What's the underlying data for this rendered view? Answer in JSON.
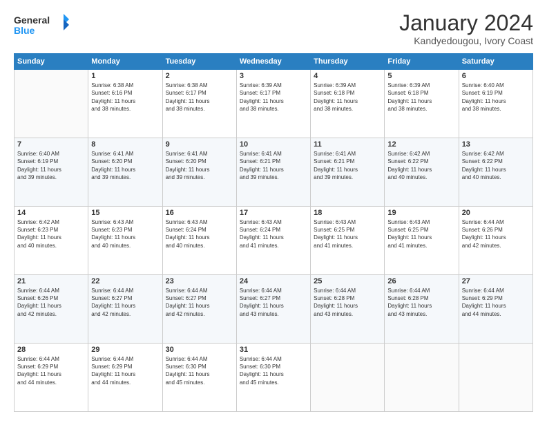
{
  "logo": {
    "text_general": "General",
    "text_blue": "Blue"
  },
  "header": {
    "month_title": "January 2024",
    "location": "Kandyedougou, Ivory Coast"
  },
  "days_of_week": [
    "Sunday",
    "Monday",
    "Tuesday",
    "Wednesday",
    "Thursday",
    "Friday",
    "Saturday"
  ],
  "weeks": [
    [
      {
        "day": "",
        "info": ""
      },
      {
        "day": "1",
        "info": "Sunrise: 6:38 AM\nSunset: 6:16 PM\nDaylight: 11 hours\nand 38 minutes."
      },
      {
        "day": "2",
        "info": "Sunrise: 6:38 AM\nSunset: 6:17 PM\nDaylight: 11 hours\nand 38 minutes."
      },
      {
        "day": "3",
        "info": "Sunrise: 6:39 AM\nSunset: 6:17 PM\nDaylight: 11 hours\nand 38 minutes."
      },
      {
        "day": "4",
        "info": "Sunrise: 6:39 AM\nSunset: 6:18 PM\nDaylight: 11 hours\nand 38 minutes."
      },
      {
        "day": "5",
        "info": "Sunrise: 6:39 AM\nSunset: 6:18 PM\nDaylight: 11 hours\nand 38 minutes."
      },
      {
        "day": "6",
        "info": "Sunrise: 6:40 AM\nSunset: 6:19 PM\nDaylight: 11 hours\nand 38 minutes."
      }
    ],
    [
      {
        "day": "7",
        "info": "Sunrise: 6:40 AM\nSunset: 6:19 PM\nDaylight: 11 hours\nand 39 minutes."
      },
      {
        "day": "8",
        "info": "Sunrise: 6:41 AM\nSunset: 6:20 PM\nDaylight: 11 hours\nand 39 minutes."
      },
      {
        "day": "9",
        "info": "Sunrise: 6:41 AM\nSunset: 6:20 PM\nDaylight: 11 hours\nand 39 minutes."
      },
      {
        "day": "10",
        "info": "Sunrise: 6:41 AM\nSunset: 6:21 PM\nDaylight: 11 hours\nand 39 minutes."
      },
      {
        "day": "11",
        "info": "Sunrise: 6:41 AM\nSunset: 6:21 PM\nDaylight: 11 hours\nand 39 minutes."
      },
      {
        "day": "12",
        "info": "Sunrise: 6:42 AM\nSunset: 6:22 PM\nDaylight: 11 hours\nand 40 minutes."
      },
      {
        "day": "13",
        "info": "Sunrise: 6:42 AM\nSunset: 6:22 PM\nDaylight: 11 hours\nand 40 minutes."
      }
    ],
    [
      {
        "day": "14",
        "info": "Sunrise: 6:42 AM\nSunset: 6:23 PM\nDaylight: 11 hours\nand 40 minutes."
      },
      {
        "day": "15",
        "info": "Sunrise: 6:43 AM\nSunset: 6:23 PM\nDaylight: 11 hours\nand 40 minutes."
      },
      {
        "day": "16",
        "info": "Sunrise: 6:43 AM\nSunset: 6:24 PM\nDaylight: 11 hours\nand 40 minutes."
      },
      {
        "day": "17",
        "info": "Sunrise: 6:43 AM\nSunset: 6:24 PM\nDaylight: 11 hours\nand 41 minutes."
      },
      {
        "day": "18",
        "info": "Sunrise: 6:43 AM\nSunset: 6:25 PM\nDaylight: 11 hours\nand 41 minutes."
      },
      {
        "day": "19",
        "info": "Sunrise: 6:43 AM\nSunset: 6:25 PM\nDaylight: 11 hours\nand 41 minutes."
      },
      {
        "day": "20",
        "info": "Sunrise: 6:44 AM\nSunset: 6:26 PM\nDaylight: 11 hours\nand 42 minutes."
      }
    ],
    [
      {
        "day": "21",
        "info": "Sunrise: 6:44 AM\nSunset: 6:26 PM\nDaylight: 11 hours\nand 42 minutes."
      },
      {
        "day": "22",
        "info": "Sunrise: 6:44 AM\nSunset: 6:27 PM\nDaylight: 11 hours\nand 42 minutes."
      },
      {
        "day": "23",
        "info": "Sunrise: 6:44 AM\nSunset: 6:27 PM\nDaylight: 11 hours\nand 42 minutes."
      },
      {
        "day": "24",
        "info": "Sunrise: 6:44 AM\nSunset: 6:27 PM\nDaylight: 11 hours\nand 43 minutes."
      },
      {
        "day": "25",
        "info": "Sunrise: 6:44 AM\nSunset: 6:28 PM\nDaylight: 11 hours\nand 43 minutes."
      },
      {
        "day": "26",
        "info": "Sunrise: 6:44 AM\nSunset: 6:28 PM\nDaylight: 11 hours\nand 43 minutes."
      },
      {
        "day": "27",
        "info": "Sunrise: 6:44 AM\nSunset: 6:29 PM\nDaylight: 11 hours\nand 44 minutes."
      }
    ],
    [
      {
        "day": "28",
        "info": "Sunrise: 6:44 AM\nSunset: 6:29 PM\nDaylight: 11 hours\nand 44 minutes."
      },
      {
        "day": "29",
        "info": "Sunrise: 6:44 AM\nSunset: 6:29 PM\nDaylight: 11 hours\nand 44 minutes."
      },
      {
        "day": "30",
        "info": "Sunrise: 6:44 AM\nSunset: 6:30 PM\nDaylight: 11 hours\nand 45 minutes."
      },
      {
        "day": "31",
        "info": "Sunrise: 6:44 AM\nSunset: 6:30 PM\nDaylight: 11 hours\nand 45 minutes."
      },
      {
        "day": "",
        "info": ""
      },
      {
        "day": "",
        "info": ""
      },
      {
        "day": "",
        "info": ""
      }
    ]
  ]
}
